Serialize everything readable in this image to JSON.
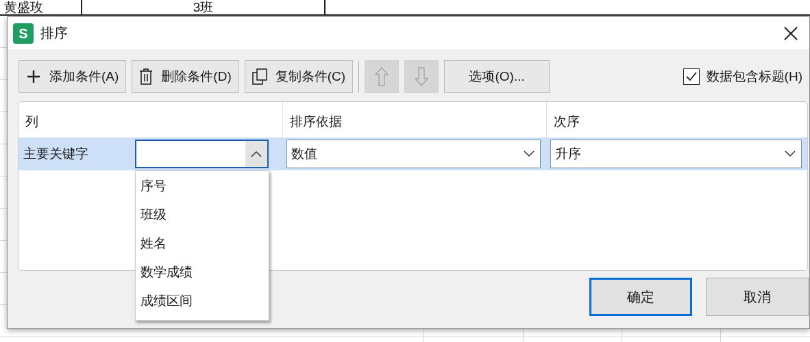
{
  "sheet": {
    "cells": [
      {
        "text": "黄盛玫"
      },
      {
        "text": "3班"
      }
    ]
  },
  "dialog": {
    "app_icon": "S",
    "title": "排序",
    "toolbar": [
      {
        "kind": "add",
        "label": "添加条件(A)",
        "disabled": false
      },
      {
        "kind": "delete",
        "label": "删除条件(D)",
        "disabled": false
      },
      {
        "kind": "copy",
        "label": "复制条件(C)",
        "disabled": false
      },
      {
        "kind": "up",
        "disabled": true
      },
      {
        "kind": "down",
        "disabled": true
      },
      {
        "kind": "options",
        "label": "选项(O)...",
        "disabled": false
      }
    ],
    "header_checkbox": {
      "label": "数据包含标题(H)",
      "checked": true
    },
    "table": {
      "columns": [
        "列",
        "排序依据",
        "次序"
      ],
      "rows": [
        {
          "label": "主要关键字",
          "selected": true,
          "column": {
            "expanded": true,
            "options": [
              "序号",
              "班级",
              "姓名",
              "数学成绩",
              "成绩区间"
            ]
          },
          "basis": "数值",
          "order": "升序"
        }
      ]
    },
    "buttons": [
      {
        "label": "确定",
        "default": true
      },
      {
        "label": "取消",
        "default": false
      }
    ]
  }
}
